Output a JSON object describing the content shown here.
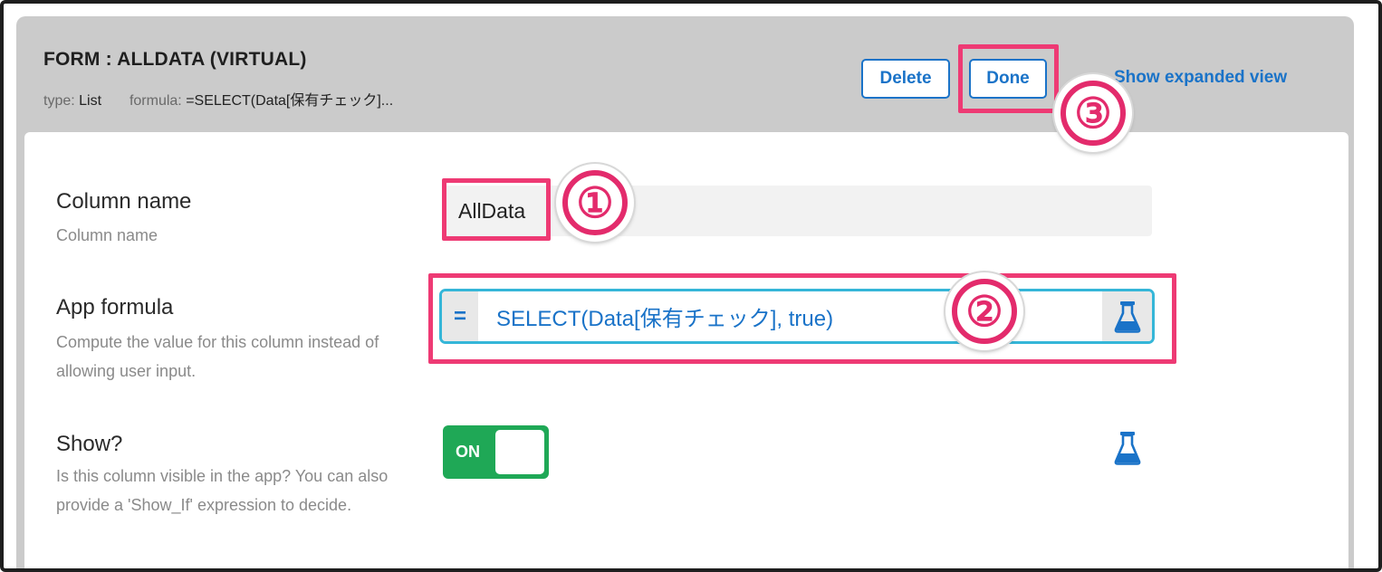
{
  "header": {
    "title": "FORM : ALLDATA (VIRTUAL)",
    "type_key": "type:",
    "type_value": "List",
    "formula_key": "formula:",
    "formula_value": "=SELECT(Data[保有チェック]...",
    "delete_label": "Delete",
    "done_label": "Done",
    "expand_label": "Show expanded view"
  },
  "fields": {
    "column_name": {
      "label": "Column name",
      "help": "Column name",
      "value": "AllData"
    },
    "app_formula": {
      "label": "App formula",
      "help": "Compute the value for this column instead of allowing user input.",
      "eq": "=",
      "value": "SELECT(Data[保有チェック], true)"
    },
    "show": {
      "label": "Show?",
      "help": "Is this column visible in the app? You can also provide a 'Show_If' expression to decide.",
      "toggle_label": "ON"
    }
  },
  "annotations": [
    "①",
    "②",
    "③"
  ],
  "colors": {
    "accent": "#1a73c8",
    "highlight": "#ee3a74",
    "toggle_on": "#1fa856",
    "formula_border": "#35b6d8"
  },
  "icons": [
    "flask-icon"
  ]
}
